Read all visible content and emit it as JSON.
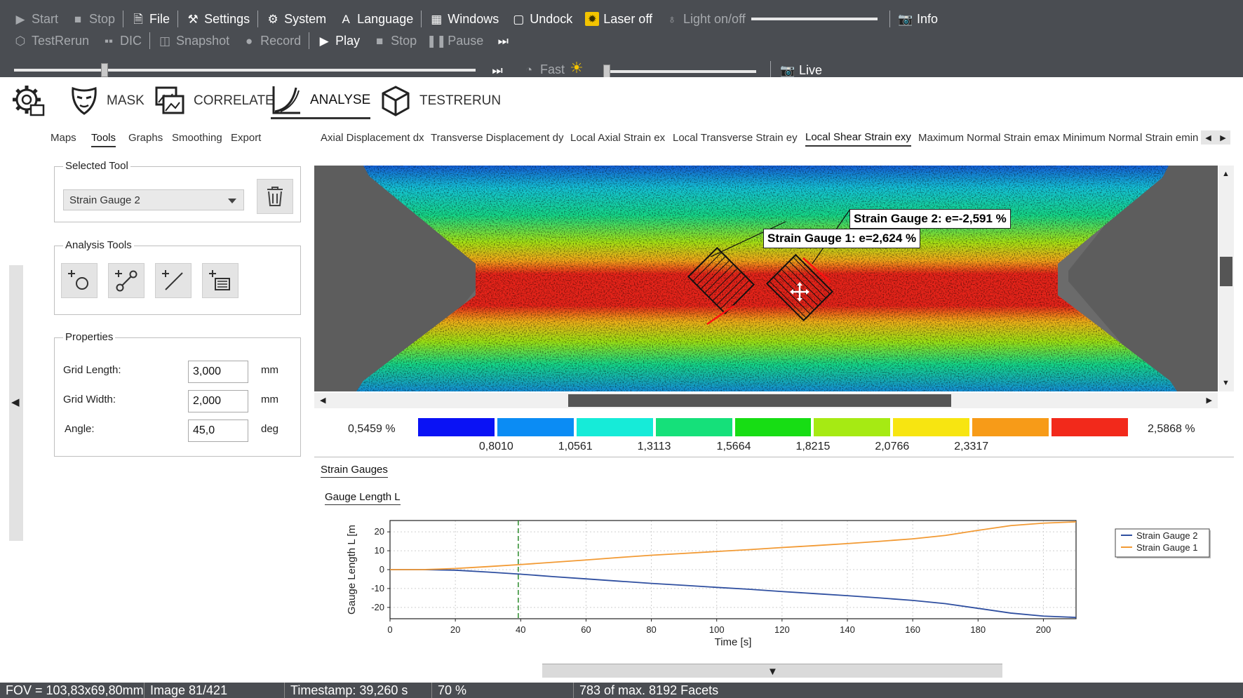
{
  "toolbar": {
    "row1": {
      "start": "Start",
      "stop": "Stop",
      "file": "File",
      "settings": "Settings",
      "system": "System",
      "language": "Language",
      "windows": "Windows",
      "undock": "Undock",
      "laser": "Laser off",
      "light": "Light on/off",
      "info": "Info"
    },
    "row2": {
      "testrerun": "TestRerun",
      "dic": "DIC",
      "snapshot": "Snapshot",
      "record": "Record",
      "play": "Play",
      "stop": "Stop",
      "pause": "Pause"
    },
    "row3": {
      "fast": "Fast",
      "live": "Live"
    }
  },
  "modules": {
    "mask": "MASK",
    "correlate": "CORRELATE",
    "analyse": "ANALYSE",
    "testrerun": "TESTRERUN"
  },
  "subtabs": [
    "Maps",
    "Tools",
    "Graphs",
    "Smoothing",
    "Export"
  ],
  "maptabs": [
    "Axial Displacement dx",
    "Transverse Displacement dy",
    "Local Axial Strain ex",
    "Local Transverse Strain ey",
    "Local Shear Strain exy",
    "Maximum Normal Strain emax",
    "Minimum Normal Strain emin"
  ],
  "selected_tool": {
    "title": "Selected Tool",
    "value": "Strain Gauge 2"
  },
  "analysis_tools": {
    "title": "Analysis Tools"
  },
  "properties": {
    "title": "Properties",
    "grid_length_label": "Grid Length:",
    "grid_length_value": "3,000",
    "grid_length_unit": "mm",
    "grid_width_label": "Grid Width:",
    "grid_width_value": "2,000",
    "grid_width_unit": "mm",
    "angle_label": "Angle:",
    "angle_value": "45,0",
    "angle_unit": "deg"
  },
  "overlay": {
    "gauge2_label": "Strain Gauge 2: e=-2,591 %",
    "gauge1_label": "Strain Gauge 1: e=2,624 %"
  },
  "legend": {
    "min": "0,5459 %",
    "max": "2,5868 %",
    "ticks": [
      "0,8010",
      "1,0561",
      "1,3113",
      "1,5664",
      "1,8215",
      "2,0766",
      "2,3317"
    ],
    "colors": [
      "#0a12f5",
      "#0b8cf4",
      "#16ebd8",
      "#15e07a",
      "#17dd14",
      "#a6ea13",
      "#f7e511",
      "#f79b18",
      "#f2291b"
    ]
  },
  "chart_tabs": {
    "strain_gauges": "Strain Gauges",
    "gauge_length": "Gauge Length L"
  },
  "chart_data": {
    "type": "line",
    "title": "",
    "xlabel": "Time [s]",
    "ylabel": "Gauge Length L [m",
    "xlim": [
      0,
      210
    ],
    "ylim": [
      -26,
      26
    ],
    "xticks": [
      0,
      20,
      40,
      60,
      80,
      100,
      120,
      140,
      160,
      180,
      200
    ],
    "yticks": [
      20,
      10,
      0,
      -10,
      -20
    ],
    "grid": true,
    "legend_position": "right",
    "cursor_x": 39.26,
    "series": [
      {
        "name": "Strain Gauge 2",
        "color": "#2f4fa0",
        "x": [
          0,
          10,
          20,
          30,
          40,
          50,
          60,
          70,
          80,
          90,
          100,
          110,
          120,
          130,
          140,
          150,
          160,
          170,
          180,
          190,
          200,
          210
        ],
        "y": [
          0,
          0,
          -0.3,
          -1.3,
          -2.4,
          -3.7,
          -4.9,
          -6.1,
          -7.3,
          -8.3,
          -9.4,
          -10.4,
          -11.6,
          -12.7,
          -13.8,
          -15.0,
          -16.3,
          -18.0,
          -20.5,
          -23.0,
          -24.6,
          -25.3
        ]
      },
      {
        "name": "Strain Gauge 1",
        "color": "#f29a34",
        "x": [
          0,
          10,
          20,
          30,
          40,
          50,
          60,
          70,
          80,
          90,
          100,
          110,
          120,
          130,
          140,
          150,
          160,
          170,
          180,
          190,
          200,
          210
        ],
        "y": [
          0,
          0,
          0.6,
          1.6,
          2.7,
          3.9,
          5.1,
          6.4,
          7.6,
          8.6,
          9.6,
          10.6,
          11.7,
          12.7,
          13.8,
          15.0,
          16.3,
          18.1,
          20.8,
          23.3,
          24.6,
          25.3
        ]
      }
    ]
  },
  "status": {
    "fov": "FOV = 103,83x69,80mm",
    "image": "Image 81/421",
    "timestamp": "Timestamp: 39,260 s",
    "zoom": "70 %",
    "facets": "783 of max. 8192 Facets"
  }
}
